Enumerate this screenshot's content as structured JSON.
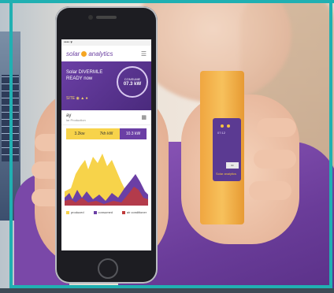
{
  "app": {
    "brand_left": "solar",
    "brand_right": "analytics",
    "status": "•••• ▾"
  },
  "hero": {
    "line1": "Solar DIVERMLE",
    "line2": "READY now",
    "circle_top": "CONSUME",
    "circle_value": "07.3 kW",
    "icons": "SITE ◉ ▲ ●"
  },
  "day": {
    "title": "ay",
    "subtitle": "lar Production",
    "cal_icon": "calendar-icon"
  },
  "pills": {
    "left_a": "3.2kw",
    "left_b": "7kh kW",
    "right": "10.3 kW"
  },
  "legend": [
    {
      "label": "produced",
      "color": "#f7d34a"
    },
    {
      "label": "consumed",
      "color": "#6b3fa5"
    },
    {
      "label": "air conditioner",
      "color": "#c03b3b"
    }
  ],
  "device": {
    "text": "07:12",
    "brand": "Solar analytics",
    "label": "ID"
  },
  "colors": {
    "accent": "#6b3fa5",
    "sun": "#f5a623",
    "device": "#f7c15c",
    "frame": "#20b0b2"
  }
}
